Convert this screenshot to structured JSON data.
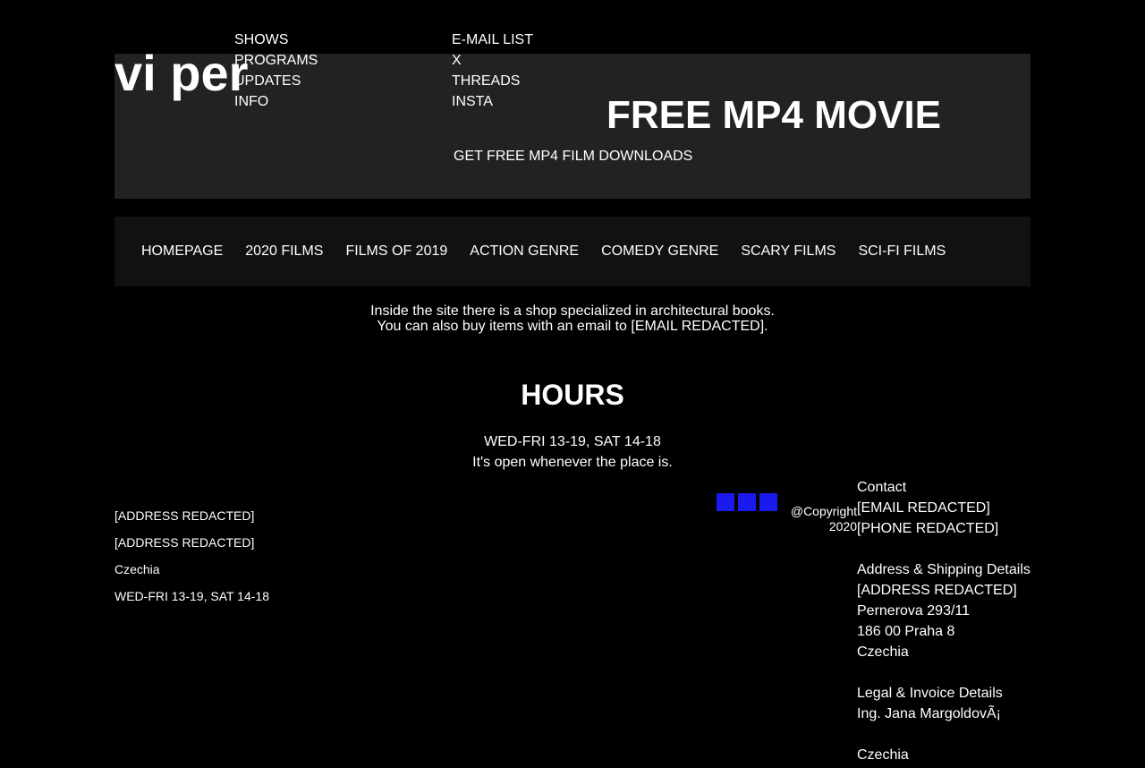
{
  "logo": "vi per",
  "top_menu_primary": [
    "SHOWS",
    "PROGRAMS",
    "UPDATES",
    "INFO"
  ],
  "top_menu_social": [
    "E-MAIL LIST",
    "X",
    "THREADS",
    "INSTA"
  ],
  "hero": {
    "title": "FREE MP4 MOVIE",
    "subtitle": "GET FREE MP4 FILM DOWNLOADS"
  },
  "nav": [
    "HOMEPAGE",
    "2020 FILMS",
    "FILMS OF 2019",
    "ACTION GENRE",
    "COMEDY GENRE",
    "SCARY FILMS",
    "SCI-FI FILMS"
  ],
  "intro": {
    "line1": "Inside the site there is a shop specialized in architectural books.",
    "line2": "You can also buy items with an email to [EMAIL REDACTED]."
  },
  "hours": {
    "title": "HOURS",
    "schedule": "WED-FRI 13-19, SAT 14-18",
    "note": "It's open whenever the place is."
  },
  "footer_left": [
    "[ADDRESS REDACTED]",
    "[ADDRESS REDACTED]",
    "Czechia",
    "WED-FRI 13-19, SAT 14-18"
  ],
  "social_icons": [
    "social-icon-1",
    "social-icon-2",
    "social-icon-3"
  ],
  "colors": {
    "social": "#1a1aee",
    "header_band": "#222222",
    "navbar": "#111111"
  },
  "copyright": {
    "line1": "@Copyright",
    "line2": "2020"
  },
  "contact": {
    "heading": "Contact",
    "email": "[EMAIL REDACTED]",
    "phone": "[PHONE REDACTED]",
    "address_heading": "Address & Shipping Details",
    "address_lines": [
      "[ADDRESS REDACTED]",
      "Pernerova 293/11",
      "186 00 Praha 8",
      "Czechia"
    ],
    "legal_heading": "Legal & Invoice Details",
    "legal_name": "Ing. Jana MargoldovÃ¡",
    "legal_country": "Czechia"
  }
}
